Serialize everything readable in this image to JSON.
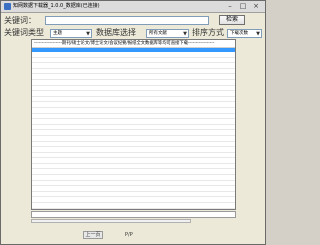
{
  "window": {
    "title": "知网数据下载器_1.0.0_数据库(已连接)"
  },
  "search": {
    "keyword_label": "关键词：",
    "keyword_value": "",
    "search_button": "检索"
  },
  "filters": {
    "keyword_type_label": "关键词类型",
    "keyword_type_value": "主题",
    "database_label": "数据库选择",
    "database_value": "所有文献",
    "sort_label": "排序方式",
    "sort_value": "下载次数"
  },
  "list": {
    "header": "------------------期刊/硕士论文/博士论文/会议纪要/报纸全文数据库等均可直接下载-----------------"
  },
  "pager": {
    "prev_label": "上一页",
    "page_label": "P/P"
  }
}
